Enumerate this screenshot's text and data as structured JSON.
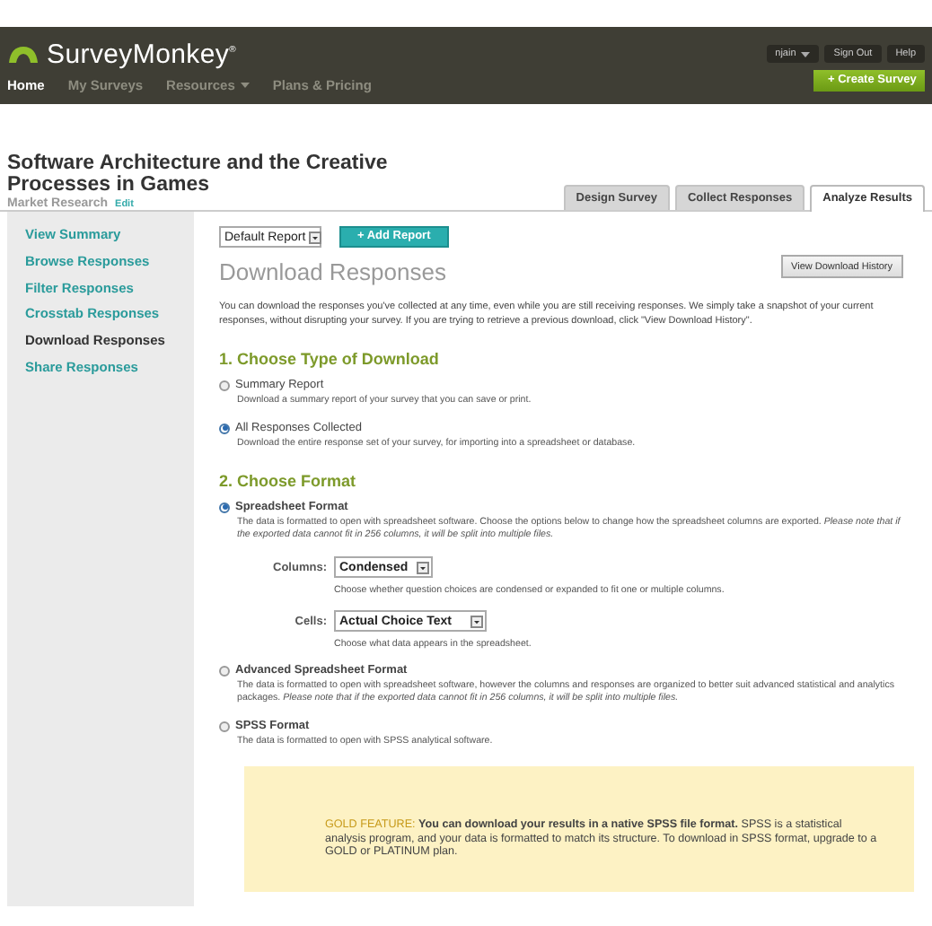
{
  "header": {
    "logo": "SurveyMonkey",
    "logo_mark": "®",
    "user_menu": "njain",
    "links": [
      "Sign Out",
      "Help"
    ],
    "nav": [
      {
        "label": "Home",
        "selected": true,
        "dropdown": false
      },
      {
        "label": "My Surveys",
        "selected": false,
        "dropdown": false
      },
      {
        "label": "Resources",
        "selected": false,
        "dropdown": true
      },
      {
        "label": "Plans & Pricing",
        "selected": false,
        "dropdown": false
      }
    ],
    "create_button": "+ Create Survey"
  },
  "survey": {
    "title": "Software Architecture and the Creative Processes in Games",
    "category": "Market Research",
    "edit": "Edit"
  },
  "tabs": [
    {
      "label": "Design Survey",
      "selected": false
    },
    {
      "label": "Collect Responses",
      "selected": false
    },
    {
      "label": "Analyze Results",
      "selected": true
    }
  ],
  "sidebar": {
    "items": [
      {
        "label": "View Summary",
        "selected": false
      },
      {
        "label": "Browse Responses",
        "selected": false
      },
      {
        "label": "Filter Responses",
        "selected": false
      },
      {
        "label": "Crosstab Responses",
        "selected": false
      },
      {
        "label": "Download Responses",
        "selected": true
      },
      {
        "label": "Share Responses",
        "selected": false
      }
    ]
  },
  "main": {
    "report_select": "Default Report",
    "add_report": "+ Add Report",
    "heading": "Download Responses",
    "history_button": "View Download History",
    "intro": "You can download the responses you've collected at any time, even while you are still receiving responses. We simply take a snapshot of your current responses, without disrupting your survey. If you are trying to retrieve a previous download, click \"View Download History\".",
    "sections": [
      {
        "kind": "type",
        "title": "1. Choose Type of Download",
        "options": [
          {
            "label": "Summary Report",
            "selected": false,
            "description": "Download a summary report of your survey that you can save or print."
          },
          {
            "label": "All Responses Collected",
            "selected": true,
            "description": "Download the entire response set of your survey, for importing into a spreadsheet or database."
          }
        ]
      },
      {
        "kind": "format",
        "title": "2. Choose Format",
        "options": [
          {
            "label": "Spreadsheet Format",
            "selected": true,
            "description": "The data is formatted to open with spreadsheet software. Choose the options below to change how the spreadsheet columns are exported. *Please note that if the exported data cannot fit in 256 columns, it will be split into multiple files.*",
            "settings": [
              {
                "label": "Columns:",
                "value": "Condensed",
                "hint": "Choose whether question choices are condensed or expanded to fit one or multiple columns."
              },
              {
                "label": "Cells:",
                "value": "Actual Choice Text",
                "hint": "Choose what data appears in the spreadsheet."
              }
            ]
          },
          {
            "label": "Advanced Spreadsheet Format",
            "selected": false,
            "description": "The data is formatted to open with spreadsheet software, however the columns and responses are organized to better suit advanced statistical and analytics packages. *Please note that if the exported data cannot fit in 256 columns, it will be split into multiple files.*"
          },
          {
            "label": "SPSS Format",
            "selected": false,
            "description": "The data is formatted to open with SPSS analytical software.",
            "notice": {
              "badge": "GOLD FEATURE:",
              "text": "**You can download your results in a native SPSS file format.** SPSS is a statistical analysis program, and your data is formatted to match its structure. To download in SPSS format, upgrade to a GOLD or PLATINUM plan."
            }
          }
        ]
      }
    ]
  }
}
